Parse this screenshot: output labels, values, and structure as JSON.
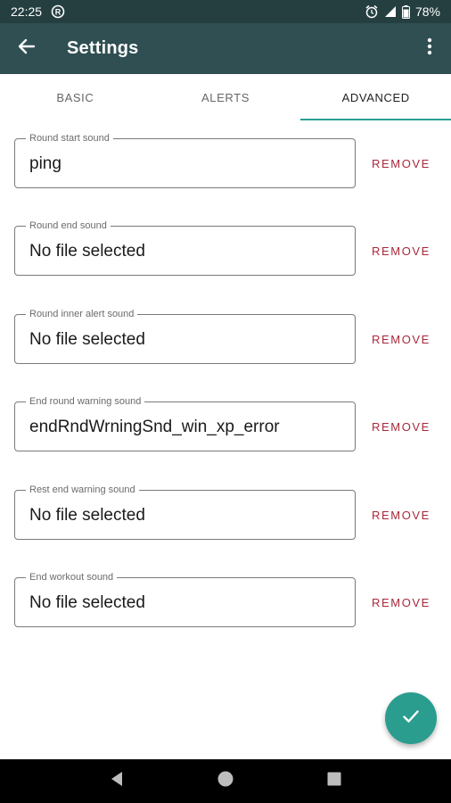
{
  "status_bar": {
    "time": "22:25",
    "battery": "78%"
  },
  "app_bar": {
    "title": "Settings"
  },
  "tabs": [
    {
      "label": "BASIC",
      "active": false
    },
    {
      "label": "ALERTS",
      "active": false
    },
    {
      "label": "ADVANCED",
      "active": true
    }
  ],
  "fields": [
    {
      "label": "Round start sound",
      "value": "ping",
      "action": "REMOVE"
    },
    {
      "label": "Round end sound",
      "value": "No file selected",
      "action": "REMOVE"
    },
    {
      "label": "Round inner alert sound",
      "value": "No file selected",
      "action": "REMOVE"
    },
    {
      "label": "End round warning sound",
      "value": "endRndWrningSnd_win_xp_error",
      "action": "REMOVE"
    },
    {
      "label": "Rest end warning sound",
      "value": "No file selected",
      "action": "REMOVE"
    },
    {
      "label": "End workout sound",
      "value": "No file selected",
      "action": "REMOVE"
    }
  ],
  "colors": {
    "status_bar": "#253f41",
    "app_bar": "#2f4f52",
    "accent": "#2a9d8f",
    "remove": "#a8283a"
  },
  "icons": {
    "back": "arrow-left-icon",
    "more": "more-vert-icon",
    "fab": "check-icon"
  }
}
